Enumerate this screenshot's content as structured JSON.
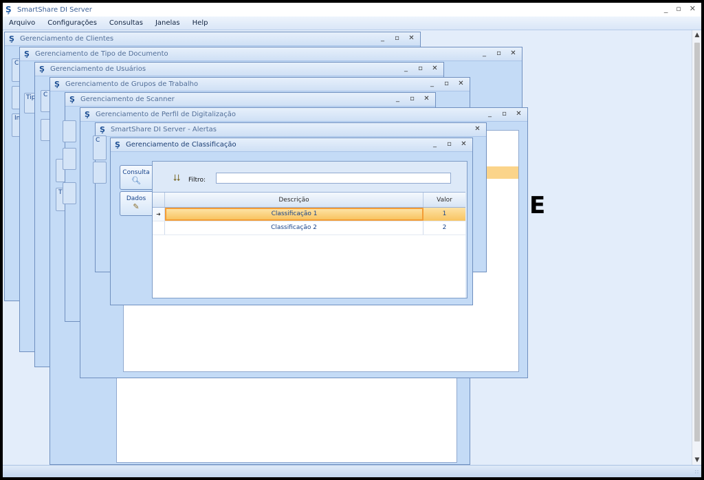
{
  "app": {
    "title": "SmartShare DI Server",
    "controls": {
      "minimize": "_",
      "restore": "▫",
      "close": "✕"
    }
  },
  "menu": {
    "items": [
      "Arquivo",
      "Configurações",
      "Consultas",
      "Janelas",
      "Help"
    ]
  },
  "windows": {
    "clientes": "Gerenciamento de Clientes",
    "tipo_documento": "Gerenciamento de Tipo de Documento",
    "usuarios": "Gerenciamento de Usuários",
    "grupos": "Gerenciamento de Grupos de Trabalho",
    "scanner": "Gerenciamento de Scanner",
    "perfil": "Gerenciamento de Perfil de Digitalização",
    "alertas": "SmartShare DI Server - Alertas",
    "classificacao": "Gerenciamento de Classificação"
  },
  "partial_labels": {
    "tip": "Tip",
    "in": "In",
    "t": "T",
    "c1": "C",
    "c2": "C",
    "c3": "C"
  },
  "classificacao": {
    "tabs": {
      "consulta": "Consulta",
      "dados": "Dados"
    },
    "filter_label": "Filtro:",
    "filter_value": "",
    "grid": {
      "columns": [
        "Descrição",
        "Valor"
      ],
      "rows": [
        {
          "descricao": "Classificação 1",
          "valor": "1",
          "selected": true
        },
        {
          "descricao": "Classificação 2",
          "valor": "2",
          "selected": false
        }
      ]
    }
  },
  "overlay_letter": "E",
  "colors": {
    "selection_fill": "#f8c461",
    "selection_border": "#f39c35",
    "window_bg": "#c4dbf6"
  }
}
